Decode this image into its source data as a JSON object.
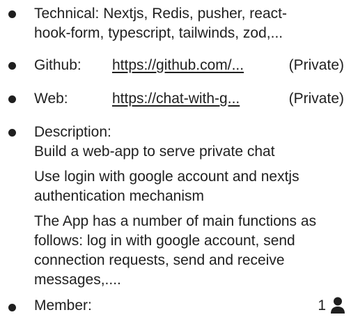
{
  "technical": {
    "line1": "Technical: Nextjs, Redis, pusher, react-",
    "line2": "hook-form, typescript, tailwinds, zod,..."
  },
  "github": {
    "label": "Github:",
    "link": "https://github.com/...",
    "privacy": "(Private)"
  },
  "web": {
    "label": "Web:",
    "link": "https://chat-with-g...",
    "privacy": "(Private)"
  },
  "description": {
    "heading": "Description:",
    "p1": "Build a web-app to serve private chat",
    "p2_line1": "Use login with google account and nextjs",
    "p2_line2": "authentication mechanism",
    "p3_line1": "The App has a number of main functions as",
    "p3_line2": "follows: log in with google account, send",
    "p3_line3": "connection requests, send and receive",
    "p3_line4": "messages,...."
  },
  "member": {
    "label": "Member:",
    "count": "1",
    "icon": "user-icon"
  },
  "colors": {
    "text": "#1f1f1f",
    "background": "#ffffff"
  }
}
